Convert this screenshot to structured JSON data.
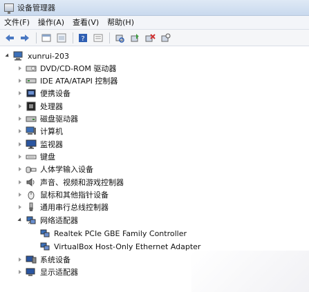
{
  "window": {
    "title": "设备管理器"
  },
  "menu": [
    "文件(F)",
    "操作(A)",
    "查看(V)",
    "帮助(H)"
  ],
  "toolbar": {
    "buttons": [
      "back-arrow-icon",
      "forward-arrow-icon",
      "properties-icon",
      "window-icon",
      "help-icon",
      "view-icon",
      "scan-hardware-icon",
      "update-driver-icon",
      "disable-device-icon",
      "uninstall-icon"
    ]
  },
  "tree": {
    "root": "xunrui-203",
    "categories": [
      {
        "label": "DVD/CD-ROM 驱动器",
        "icon": "dvd-drive-icon"
      },
      {
        "label": "IDE ATA/ATAPI 控制器",
        "icon": "ide-controller-icon"
      },
      {
        "label": "便携设备",
        "icon": "portable-device-icon"
      },
      {
        "label": "处理器",
        "icon": "processor-icon"
      },
      {
        "label": "磁盘驱动器",
        "icon": "disk-drive-icon"
      },
      {
        "label": "计算机",
        "icon": "computer-icon"
      },
      {
        "label": "监视器",
        "icon": "monitor-icon"
      },
      {
        "label": "键盘",
        "icon": "keyboard-icon"
      },
      {
        "label": "人体学输入设备",
        "icon": "hid-icon"
      },
      {
        "label": "声音、视频和游戏控制器",
        "icon": "sound-icon"
      },
      {
        "label": "鼠标和其他指针设备",
        "icon": "mouse-icon"
      },
      {
        "label": "通用串行总线控制器",
        "icon": "usb-icon"
      },
      {
        "label": "网络适配器",
        "icon": "network-adapter-icon",
        "expanded": true,
        "children": [
          {
            "label": "Realtek PCIe GBE Family Controller",
            "icon": "network-device-icon"
          },
          {
            "label": "VirtualBox Host-Only Ethernet Adapter",
            "icon": "network-device-icon"
          }
        ]
      },
      {
        "label": "系统设备",
        "icon": "system-device-icon"
      },
      {
        "label": "显示适配器",
        "icon": "display-adapter-icon"
      }
    ]
  }
}
